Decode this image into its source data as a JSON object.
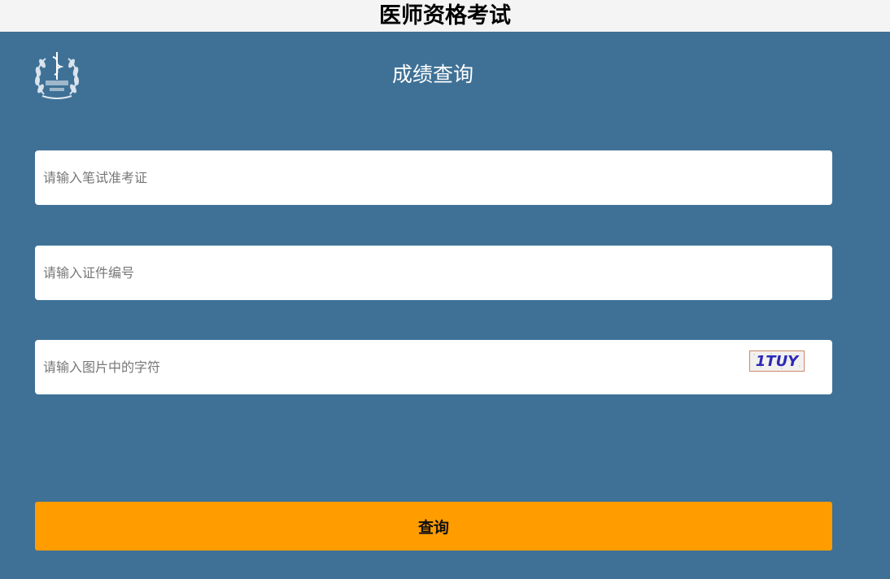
{
  "header": {
    "title": "医师资格考试"
  },
  "panel": {
    "subtitle": "成绩查询",
    "logo_icon": "medical-caduceus-emblem-icon",
    "logo_text": "国家医学考试中心",
    "logo_abbr": "NMEC"
  },
  "form": {
    "exam_id_placeholder": "请输入笔试准考证",
    "id_number_placeholder": "请输入证件编号",
    "captcha_placeholder": "请输入图片中的字符",
    "captcha_text": "1TUY",
    "submit_label": "查询"
  },
  "colors": {
    "background": "#3f7196",
    "topbar": "#f4f4f4",
    "button": "#ff9c00",
    "captcha_text": "#2b2ab8"
  }
}
